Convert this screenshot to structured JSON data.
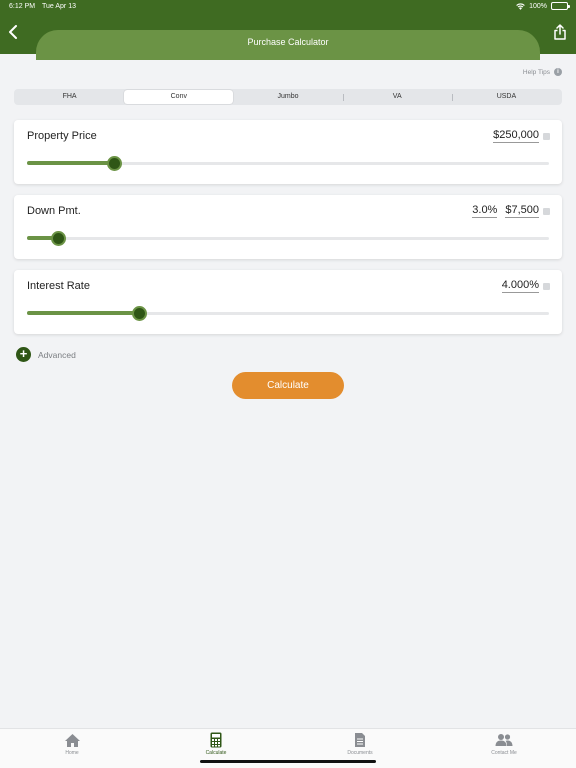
{
  "status_bar": {
    "time": "6:12 PM",
    "date": "Tue Apr 13",
    "battery": "100%",
    "battery_level": 1.0
  },
  "header": {
    "title": "Purchase Calculator",
    "back_icon": "chevron-left-icon",
    "share_icon": "share-icon"
  },
  "help_tips": {
    "label": "Help Tips",
    "icon_glyph": "i"
  },
  "loan_types": {
    "items": [
      "FHA",
      "Conv",
      "Jumbo",
      "VA",
      "USDA"
    ],
    "selected": "Conv"
  },
  "property_price": {
    "label": "Property Price",
    "value": "$250,000",
    "slider_fraction": 0.167
  },
  "down_payment": {
    "label": "Down Pmt.",
    "percent": "3.0%",
    "amount": "$7,500",
    "slider_fraction": 0.06
  },
  "interest_rate": {
    "label": "Interest Rate",
    "value": "4.000%",
    "slider_fraction": 0.215
  },
  "advanced": {
    "label": "Advanced",
    "icon_glyph": "+"
  },
  "calculate": {
    "label": "Calculate"
  },
  "tabbar": {
    "items": [
      {
        "label": "Home",
        "icon": "home-icon"
      },
      {
        "label": "Calculate",
        "icon": "calculator-icon"
      },
      {
        "label": "Documents",
        "icon": "document-icon"
      },
      {
        "label": "Contact Me",
        "icon": "people-icon"
      }
    ],
    "active": "Calculate"
  },
  "colors": {
    "brand_dark": "#3f6b22",
    "brand_light": "#6b9345",
    "thumb": "#2f5616",
    "accent_orange": "#e38d2e",
    "background": "#f2f3f5"
  }
}
